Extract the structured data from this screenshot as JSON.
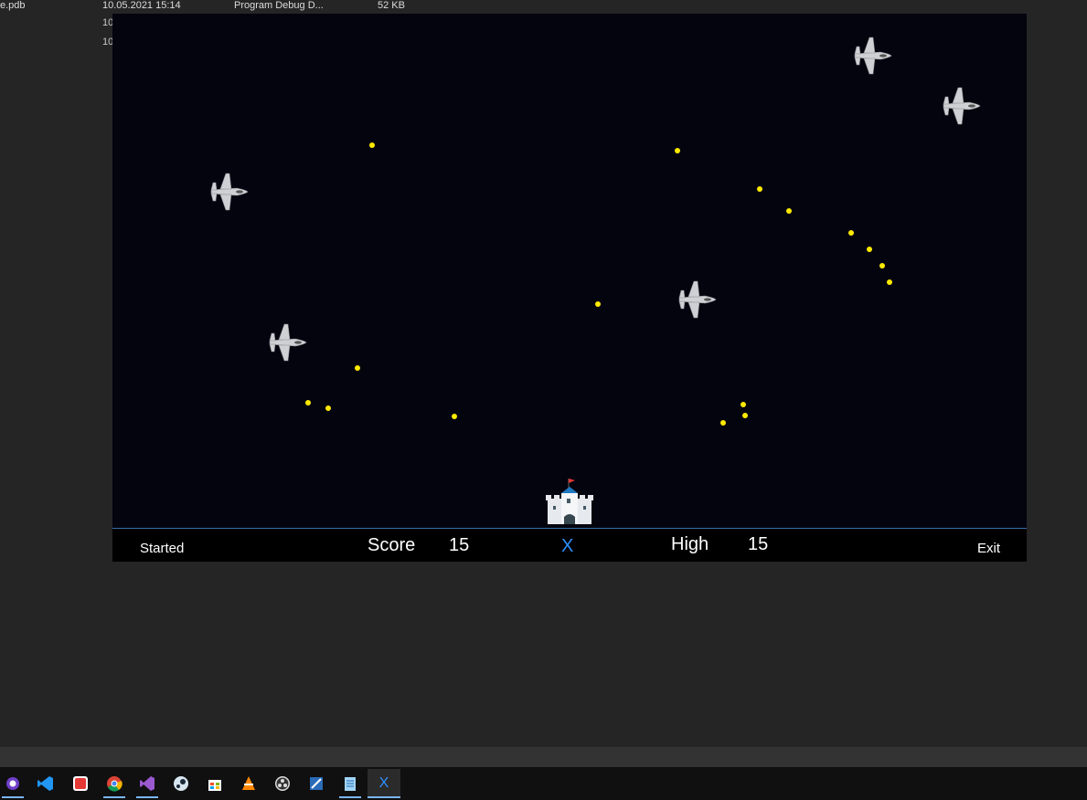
{
  "explorer": {
    "filename": "e.pdb",
    "date": "10.05.2021 15:14",
    "type": "Program Debug D...",
    "size": "52 KB",
    "row2_stub": "10",
    "row3_stub": "10"
  },
  "game": {
    "status": "Started",
    "score_label": "Score",
    "score": "15",
    "close_label": "X",
    "high_label": "High",
    "high_score": "15",
    "exit_label": "Exit",
    "bullet_color": "#ffea00",
    "background_color": "#04040f",
    "enemies": [
      "fighter-jet",
      "fighter-jet",
      "fighter-jet",
      "fighter-jet",
      "fighter-jet"
    ],
    "player": "castle-icon"
  },
  "taskbar": {
    "apps": [
      "github-desktop-icon",
      "vscode-icon",
      "yandex-browser-icon",
      "chrome-icon",
      "visual-studio-icon",
      "steam-icon",
      "store-icon",
      "vlc-icon",
      "obs-icon",
      "ssms-icon",
      "notepad-icon",
      "game-app-icon"
    ],
    "game_app_label": "X"
  }
}
